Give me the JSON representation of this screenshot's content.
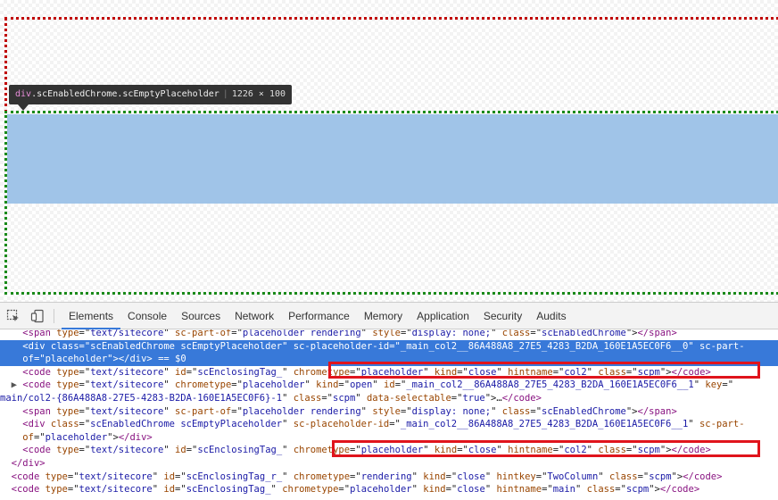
{
  "tooltip": {
    "tag": "div",
    "classes": ".scEnabledChrome.scEmptyPlaceholder",
    "dimensions": "1226 × 100"
  },
  "devtools": {
    "tabs": [
      "Elements",
      "Console",
      "Sources",
      "Network",
      "Performance",
      "Memory",
      "Application",
      "Security",
      "Audits"
    ],
    "active_tab": "Elements",
    "icons": [
      "inspect-element-icon",
      "device-toolbar-icon"
    ],
    "lines": [
      {
        "indent": "    ",
        "parts": [
          {
            "k": "t",
            "s": "<span "
          },
          {
            "k": "a",
            "s": "type"
          },
          {
            "k": "p",
            "s": "=\""
          },
          {
            "k": "v",
            "s": "text/sitecore"
          },
          {
            "k": "p",
            "s": "\" "
          },
          {
            "k": "a",
            "s": "sc-part-of"
          },
          {
            "k": "p",
            "s": "=\""
          },
          {
            "k": "v",
            "s": "placeholder rendering"
          },
          {
            "k": "p",
            "s": "\" "
          },
          {
            "k": "a",
            "s": "style"
          },
          {
            "k": "p",
            "s": "=\""
          },
          {
            "k": "v",
            "s": "display: none;"
          },
          {
            "k": "p",
            "s": "\" "
          },
          {
            "k": "a",
            "s": "class"
          },
          {
            "k": "p",
            "s": "=\""
          },
          {
            "k": "v",
            "s": "scEnabledChrome"
          },
          {
            "k": "p",
            "s": "\">"
          },
          {
            "k": "t",
            "s": "</span>"
          }
        ]
      },
      {
        "indent": "    ",
        "selected": true,
        "parts": [
          {
            "k": "t",
            "s": "<div "
          },
          {
            "k": "a",
            "s": "class"
          },
          {
            "k": "p",
            "s": "=\""
          },
          {
            "k": "v",
            "s": "scEnabledChrome scEmptyPlaceholder"
          },
          {
            "k": "p",
            "s": "\" "
          },
          {
            "k": "a",
            "s": "sc-placeholder-id"
          },
          {
            "k": "p",
            "s": "=\""
          },
          {
            "k": "v",
            "s": "_main_col2__86A488A8_27E5_4283_B2DA_160E1A5EC0F6__0"
          },
          {
            "k": "p",
            "s": "\" "
          },
          {
            "k": "a",
            "s": "sc-part-"
          }
        ]
      },
      {
        "indent": "    ",
        "selected": true,
        "parts": [
          {
            "k": "v",
            "s": "of"
          },
          {
            "k": "p",
            "s": "=\""
          },
          {
            "k": "v",
            "s": "placeholder"
          },
          {
            "k": "p",
            "s": "\">"
          },
          {
            "k": "t",
            "s": "</div>"
          },
          {
            "k": "p",
            "s": " == $0"
          }
        ]
      },
      {
        "indent": "    ",
        "parts": [
          {
            "k": "t",
            "s": "<code "
          },
          {
            "k": "a",
            "s": "type"
          },
          {
            "k": "p",
            "s": "=\""
          },
          {
            "k": "v",
            "s": "text/sitecore"
          },
          {
            "k": "p",
            "s": "\" "
          },
          {
            "k": "a",
            "s": "id"
          },
          {
            "k": "p",
            "s": "=\""
          },
          {
            "k": "v",
            "s": "scEnclosingTag_"
          },
          {
            "k": "p",
            "s": "\" "
          },
          {
            "k": "a",
            "s": "chrometype"
          },
          {
            "k": "p",
            "s": "=\""
          },
          {
            "k": "v",
            "s": "placeholder"
          },
          {
            "k": "p",
            "s": "\" "
          },
          {
            "k": "a",
            "s": "kind"
          },
          {
            "k": "p",
            "s": "=\""
          },
          {
            "k": "v",
            "s": "close"
          },
          {
            "k": "p",
            "s": "\" "
          },
          {
            "k": "a",
            "s": "hintname"
          },
          {
            "k": "p",
            "s": "=\""
          },
          {
            "k": "v",
            "s": "col2"
          },
          {
            "k": "p",
            "s": "\" "
          },
          {
            "k": "a",
            "s": "class"
          },
          {
            "k": "p",
            "s": "=\""
          },
          {
            "k": "v",
            "s": "scpm"
          },
          {
            "k": "p",
            "s": "\">"
          },
          {
            "k": "t",
            "s": "</code>"
          }
        ]
      },
      {
        "indent": "  ",
        "triangle": "▶ ",
        "parts": [
          {
            "k": "t",
            "s": "<code "
          },
          {
            "k": "a",
            "s": "type"
          },
          {
            "k": "p",
            "s": "=\""
          },
          {
            "k": "v",
            "s": "text/sitecore"
          },
          {
            "k": "p",
            "s": "\" "
          },
          {
            "k": "a",
            "s": "chrometype"
          },
          {
            "k": "p",
            "s": "=\""
          },
          {
            "k": "v",
            "s": "placeholder"
          },
          {
            "k": "p",
            "s": "\" "
          },
          {
            "k": "a",
            "s": "kind"
          },
          {
            "k": "p",
            "s": "=\""
          },
          {
            "k": "v",
            "s": "open"
          },
          {
            "k": "p",
            "s": "\" "
          },
          {
            "k": "a",
            "s": "id"
          },
          {
            "k": "p",
            "s": "=\""
          },
          {
            "k": "v",
            "s": "_main_col2__86A488A8_27E5_4283_B2DA_160E1A5EC0F6__1"
          },
          {
            "k": "p",
            "s": "\" "
          },
          {
            "k": "a",
            "s": "key"
          },
          {
            "k": "p",
            "s": "=\""
          }
        ]
      },
      {
        "indent": "",
        "parts": [
          {
            "k": "v",
            "s": "main/col2-{86A488A8-27E5-4283-B2DA-160E1A5EC0F6}-1"
          },
          {
            "k": "p",
            "s": "\" "
          },
          {
            "k": "a",
            "s": "class"
          },
          {
            "k": "p",
            "s": "=\""
          },
          {
            "k": "v",
            "s": "scpm"
          },
          {
            "k": "p",
            "s": "\" "
          },
          {
            "k": "a",
            "s": "data-selectable"
          },
          {
            "k": "p",
            "s": "=\""
          },
          {
            "k": "v",
            "s": "true"
          },
          {
            "k": "p",
            "s": "\">…"
          },
          {
            "k": "t",
            "s": "</code>"
          }
        ]
      },
      {
        "indent": "    ",
        "parts": [
          {
            "k": "t",
            "s": "<span "
          },
          {
            "k": "a",
            "s": "type"
          },
          {
            "k": "p",
            "s": "=\""
          },
          {
            "k": "v",
            "s": "text/sitecore"
          },
          {
            "k": "p",
            "s": "\" "
          },
          {
            "k": "a",
            "s": "sc-part-of"
          },
          {
            "k": "p",
            "s": "=\""
          },
          {
            "k": "v",
            "s": "placeholder rendering"
          },
          {
            "k": "p",
            "s": "\" "
          },
          {
            "k": "a",
            "s": "style"
          },
          {
            "k": "p",
            "s": "=\""
          },
          {
            "k": "v",
            "s": "display: none;"
          },
          {
            "k": "p",
            "s": "\" "
          },
          {
            "k": "a",
            "s": "class"
          },
          {
            "k": "p",
            "s": "=\""
          },
          {
            "k": "v",
            "s": "scEnabledChrome"
          },
          {
            "k": "p",
            "s": "\">"
          },
          {
            "k": "t",
            "s": "</span>"
          }
        ]
      },
      {
        "indent": "    ",
        "parts": [
          {
            "k": "t",
            "s": "<div "
          },
          {
            "k": "a",
            "s": "class"
          },
          {
            "k": "p",
            "s": "=\""
          },
          {
            "k": "v",
            "s": "scEnabledChrome scEmptyPlaceholder"
          },
          {
            "k": "p",
            "s": "\" "
          },
          {
            "k": "a",
            "s": "sc-placeholder-id"
          },
          {
            "k": "p",
            "s": "=\""
          },
          {
            "k": "v",
            "s": "_main_col2__86A488A8_27E5_4283_B2DA_160E1A5EC0F6__1"
          },
          {
            "k": "p",
            "s": "\" "
          },
          {
            "k": "a",
            "s": "sc-part-"
          }
        ]
      },
      {
        "indent": "    ",
        "parts": [
          {
            "k": "a",
            "s": "of"
          },
          {
            "k": "p",
            "s": "=\""
          },
          {
            "k": "v",
            "s": "placeholder"
          },
          {
            "k": "p",
            "s": "\">"
          },
          {
            "k": "t",
            "s": "</div>"
          }
        ]
      },
      {
        "indent": "    ",
        "parts": [
          {
            "k": "t",
            "s": "<code "
          },
          {
            "k": "a",
            "s": "type"
          },
          {
            "k": "p",
            "s": "=\""
          },
          {
            "k": "v",
            "s": "text/sitecore"
          },
          {
            "k": "p",
            "s": "\" "
          },
          {
            "k": "a",
            "s": "id"
          },
          {
            "k": "p",
            "s": "=\""
          },
          {
            "k": "v",
            "s": "scEnclosingTag_"
          },
          {
            "k": "p",
            "s": "\" "
          },
          {
            "k": "a",
            "s": "chrometype"
          },
          {
            "k": "p",
            "s": "=\""
          },
          {
            "k": "v",
            "s": "placeholder"
          },
          {
            "k": "p",
            "s": "\" "
          },
          {
            "k": "a",
            "s": "kind"
          },
          {
            "k": "p",
            "s": "=\""
          },
          {
            "k": "v",
            "s": "close"
          },
          {
            "k": "p",
            "s": "\" "
          },
          {
            "k": "a",
            "s": "hintname"
          },
          {
            "k": "p",
            "s": "=\""
          },
          {
            "k": "v",
            "s": "col2"
          },
          {
            "k": "p",
            "s": "\" "
          },
          {
            "k": "a",
            "s": "class"
          },
          {
            "k": "p",
            "s": "=\""
          },
          {
            "k": "v",
            "s": "scpm"
          },
          {
            "k": "p",
            "s": "\">"
          },
          {
            "k": "t",
            "s": "</code>"
          }
        ]
      },
      {
        "indent": "  ",
        "parts": [
          {
            "k": "t",
            "s": "</div>"
          }
        ]
      },
      {
        "indent": "  ",
        "parts": [
          {
            "k": "t",
            "s": "<code "
          },
          {
            "k": "a",
            "s": "type"
          },
          {
            "k": "p",
            "s": "=\""
          },
          {
            "k": "v",
            "s": "text/sitecore"
          },
          {
            "k": "p",
            "s": "\" "
          },
          {
            "k": "a",
            "s": "id"
          },
          {
            "k": "p",
            "s": "=\""
          },
          {
            "k": "v",
            "s": "scEnclosingTag_r_"
          },
          {
            "k": "p",
            "s": "\" "
          },
          {
            "k": "a",
            "s": "chrometype"
          },
          {
            "k": "p",
            "s": "=\""
          },
          {
            "k": "v",
            "s": "rendering"
          },
          {
            "k": "p",
            "s": "\" "
          },
          {
            "k": "a",
            "s": "kind"
          },
          {
            "k": "p",
            "s": "=\""
          },
          {
            "k": "v",
            "s": "close"
          },
          {
            "k": "p",
            "s": "\" "
          },
          {
            "k": "a",
            "s": "hintkey"
          },
          {
            "k": "p",
            "s": "=\""
          },
          {
            "k": "v",
            "s": "TwoColumn"
          },
          {
            "k": "p",
            "s": "\" "
          },
          {
            "k": "a",
            "s": "class"
          },
          {
            "k": "p",
            "s": "=\""
          },
          {
            "k": "v",
            "s": "scpm"
          },
          {
            "k": "p",
            "s": "\">"
          },
          {
            "k": "t",
            "s": "</code>"
          }
        ]
      },
      {
        "indent": "  ",
        "parts": [
          {
            "k": "t",
            "s": "<code "
          },
          {
            "k": "a",
            "s": "type"
          },
          {
            "k": "p",
            "s": "=\""
          },
          {
            "k": "v",
            "s": "text/sitecore"
          },
          {
            "k": "p",
            "s": "\" "
          },
          {
            "k": "a",
            "s": "id"
          },
          {
            "k": "p",
            "s": "=\""
          },
          {
            "k": "v",
            "s": "scEnclosingTag_"
          },
          {
            "k": "p",
            "s": "\" "
          },
          {
            "k": "a",
            "s": "chrometype"
          },
          {
            "k": "p",
            "s": "=\""
          },
          {
            "k": "v",
            "s": "placeholder"
          },
          {
            "k": "p",
            "s": "\" "
          },
          {
            "k": "a",
            "s": "kind"
          },
          {
            "k": "p",
            "s": "=\""
          },
          {
            "k": "v",
            "s": "close"
          },
          {
            "k": "p",
            "s": "\" "
          },
          {
            "k": "a",
            "s": "hintname"
          },
          {
            "k": "p",
            "s": "=\""
          },
          {
            "k": "v",
            "s": "main"
          },
          {
            "k": "p",
            "s": "\" "
          },
          {
            "k": "a",
            "s": "class"
          },
          {
            "k": "p",
            "s": "=\""
          },
          {
            "k": "v",
            "s": "scpm"
          },
          {
            "k": "p",
            "s": "\">"
          },
          {
            "k": "t",
            "s": "</code>"
          }
        ]
      }
    ]
  }
}
